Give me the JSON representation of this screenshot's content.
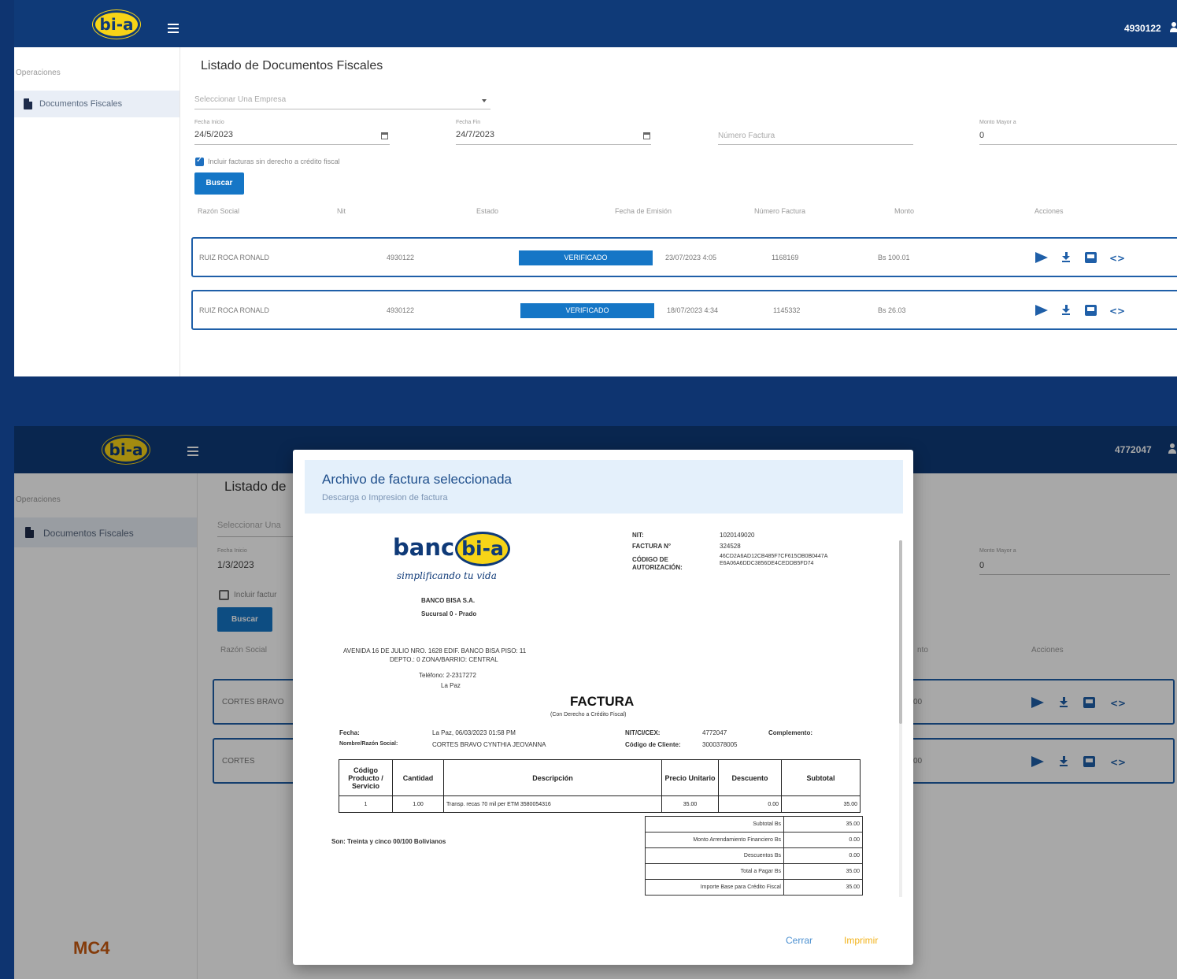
{
  "screen_a": {
    "user_id": "4930122",
    "logo_text": "bi-a",
    "sidebar": {
      "section": "Operaciones",
      "item": "Documentos Fiscales"
    },
    "page_title": "Listado de Documentos Fiscales",
    "company_select": {
      "placeholder": "Seleccionar Una Empresa"
    },
    "fecha_inicio": {
      "label": "Fecha Inicio",
      "value": "24/5/2023"
    },
    "fecha_fin": {
      "label": "Fecha Fin",
      "value": "24/7/2023"
    },
    "numero_factura": {
      "placeholder": "Número Factura"
    },
    "monto_mayor": {
      "label": "Monto Mayor a",
      "value": "0"
    },
    "include_checkbox": {
      "label": "Incluir facturas sin derecho a crédito fiscal",
      "checked": true
    },
    "search_button": "Buscar",
    "columns": [
      "Razón Social",
      "Nit",
      "Estado",
      "Fecha de Emisión",
      "Número Factura",
      "Monto",
      "Acciones"
    ],
    "rows": [
      {
        "razon_social": "RUIZ ROCA RONALD",
        "nit": "4930122",
        "estado": "VERIFICADO",
        "fecha": "23/07/2023 4:05",
        "numero": "1168169",
        "monto": "Bs 100.01"
      },
      {
        "razon_social": "RUIZ ROCA RONALD",
        "nit": "4930122",
        "estado": "VERIFICADO",
        "fecha": "18/07/2023 4:34",
        "numero": "1145332",
        "monto": "Bs 26.03"
      }
    ]
  },
  "screen_b": {
    "user_id": "4772047",
    "logo_text": "bi-a",
    "sidebar": {
      "section": "Operaciones",
      "item": "Documentos Fiscales"
    },
    "page_title": "Listado de",
    "company_select_partial": "Seleccionar Una",
    "fecha_inicio": {
      "label": "Fecha Inicio",
      "value": "1/3/2023"
    },
    "monto_mayor": {
      "label": "Monto Mayor a",
      "value": "0"
    },
    "include_partial": "Incluir factur",
    "search_button": "Buscar",
    "col_razon": "Razón Social",
    "col_monto_partial": "nto",
    "col_acciones": "Acciones",
    "rows": [
      {
        "razon_social": "CORTES BRAVO",
        "monto_partial": "00"
      },
      {
        "razon_social": "CORTES",
        "monto_partial": "00"
      }
    ],
    "footer_logo": "MC4"
  },
  "modal": {
    "title": "Archivo de factura seleccionada",
    "subtitle": "Descarga o Impresion de factura",
    "close_button": "Cerrar",
    "print_button": "Imprimir",
    "invoice": {
      "brand_word": "banco",
      "brand_pill": "bi-a",
      "tagline": "simplificando tu vida",
      "company": "BANCO BISA S.A.",
      "branch": "Sucursal 0 - Prado",
      "address_1": "AVENIDA 16 DE JULIO NRO. 1628 EDIF. BANCO BISA PISO: 11",
      "address_2": "DEPTO.: 0 ZONA/BARRIO: CENTRAL",
      "phone": "Teléfono: 2-2317272",
      "city": "La Paz",
      "nit_label": "NIT:",
      "nit_value": "1020149020",
      "factura_label": "FACTURA N°",
      "factura_value": "324528",
      "codigo_label_1": "CÓDIGO DE",
      "codigo_label_2": "AUTORIZACIÓN:",
      "codigo_value_1": "46CD2A6AD12CB485F7CF615OB0B0447A",
      "codigo_value_2": "E6A06A6DDC3856DE4CEDDB5FD74",
      "heading": "FACTURA",
      "subheading": "(Con Derecho a Crédito Fiscal)",
      "fecha_label": "Fecha:",
      "fecha_value": "La Paz, 06/03/2023 01:58 PM",
      "razon_label": "Nombre/Razón Social:",
      "razon_value": "CORTES BRAVO CYNTHIA JEOVANNA",
      "nitci_label": "NIT/CI/CEX:",
      "nitci_value": "4772047",
      "complemento_label": "Complemento:",
      "cliente_label": "Código de Cliente:",
      "cliente_value": "3000378005",
      "table_headers": [
        "Código Producto / Servicio",
        "Cantidad",
        "Descripción",
        "Precio Unitario",
        "Descuento",
        "Subtotal"
      ],
      "table_row": [
        "1",
        "1.00",
        "Transp. recas 70 mil per ETM   3580054316",
        "35.00",
        "0.00",
        "35.00"
      ],
      "totals": [
        {
          "label": "Subtotal Bs",
          "value": "35.00"
        },
        {
          "label": "Monto Arrendamiento Financiero Bs",
          "value": "0.00"
        },
        {
          "label": "Descuentos Bs",
          "value": "0.00"
        },
        {
          "label": "Total a Pagar Bs",
          "value": "35.00"
        },
        {
          "label": "Importe Base para Crédito Fiscal",
          "value": "35.00"
        }
      ],
      "son": "Son: Treinta y cinco 00/100 Bolivianos"
    }
  }
}
